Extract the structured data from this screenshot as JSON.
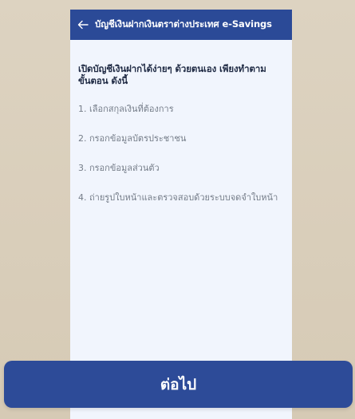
{
  "colors": {
    "header_bg": "#2b4a97",
    "button_bg": "#2d4b98",
    "screen_bg": "#f1f5fd",
    "backdrop": "#d8cdb9",
    "intro_text": "#1f2a44",
    "step_text": "#757d89"
  },
  "header": {
    "back_icon": "arrow-left-icon",
    "title": "บัญชีเงินฝากเงินตราต่างประเทศ e-Savings"
  },
  "intro": {
    "line1": "เปิดบัญชีเงินฝากได้ง่ายๆ ด้วยตนเอง เพียงทำตาม",
    "line2": "ขั้นตอน ดังนี้"
  },
  "steps": [
    "1. เลือกสกุลเงินที่ต้องการ",
    "2. กรอกข้อมูลบัตรประชาชน",
    "3. กรอกข้อมูลส่วนตัว",
    "4. ถ่ายรูปใบหน้าและตรวจสอบด้วยระบบจดจำใบหน้า"
  ],
  "button": {
    "label": "ต่อไป"
  }
}
